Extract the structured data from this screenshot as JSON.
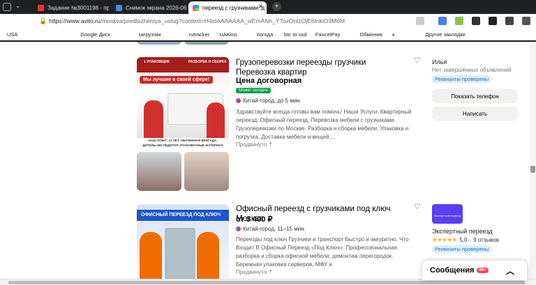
{
  "browser": {
    "tabs": [
      {
        "label": "Задание №3001198 - про"
      },
      {
        "label": "Снимок экрана 2026-06-1"
      },
      {
        "label": "переезд с грузчиками: д"
      }
    ],
    "url_host": "https://www.avito.ru",
    "url_path": "/moskva/predlozheniya_uslug?context=H4sIAAAAAAA_wEmANn_YToxOntzOjE6InkiO3M6M",
    "bookmarks": [
      "USA",
      "Google Диск",
      "загрузчик",
      "rutracker",
      "UAKino",
      "погода",
      "btc to usd",
      "FaucetPay",
      "Обмінник",
      "к",
      "Другие закладки"
    ]
  },
  "listings": [
    {
      "photo_text": [
        "1 УПАКОВЩИК",
        "РАЗБОРКА И СБОРКА",
        "Мы лучшие в своей сфере!",
        "НАШ ОПЫТ: 12 ЛЕТ. ОБУЧЕННАЯ БРИГАДА.",
        "ДИТЕЛЬ-ЭКСПЕДИТОР. УПАКОВОЧНЫЕ МАТЕРИАЛ"
      ],
      "title": "Грузоперевозки переезды грузчики Перевозка квартир",
      "price": "Цена договорная",
      "badge": "Может сегодня",
      "location": "Китай-город, до 5 мин.",
      "description": "Здравствуйте всегда готовы вам помочь! Наши Услуги: Квартирный переезд. Офисный переезд. Перевозка мебели с грузчиками. Грузоперевозки по Москве. Разборка и сборка мебели. Упаковка и погрузка. Доставка мебели и вещей....",
      "promoted": "Продвинуто"
    },
    {
      "photo_text": [
        "ОФИСНЫЙ ПЕРЕЕЗД ПОД КЛЮЧ"
      ],
      "title": "Офисный переезд с грузчиками под ключ Москва",
      "price": "от 3 400 ₽",
      "location": "Китай-город, 11–15 мин.",
      "description": "Переезды под ключ Грузчики и транспорт Быстро и аккуратно. Что Входит В Офисный Переезд «Под Ключ»: Профессиональная разборка и сборка офисной мебели, демонтаж перегородок. Бережная упаковка серверов, МФУ и",
      "promoted": "Продвинуто"
    }
  ],
  "sellers": [
    {
      "name": "Илья",
      "sub": "Нет завершённых объявлений",
      "pill": "Реквизиты проверены",
      "btn_phone": "Показать телефон",
      "btn_write": "Написать"
    },
    {
      "logo": "Экспертный переезд",
      "name": "Экспертный переезд",
      "rating": "5,0",
      "reviews": "9 отзывов",
      "stars": 5,
      "pill": "Реквизиты проверены"
    }
  ],
  "messages": {
    "label": "Сообщения",
    "count": "99+"
  }
}
